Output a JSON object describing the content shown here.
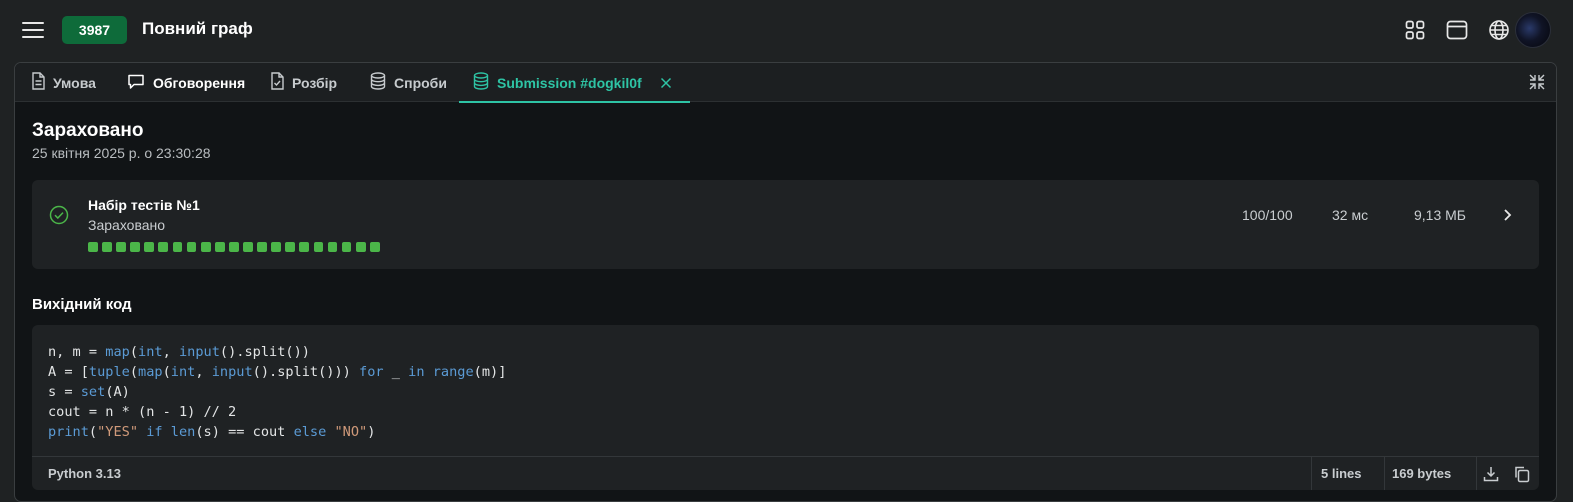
{
  "header": {
    "problem_id": "3987",
    "title": "Повний граф",
    "icons": [
      "apps-grid-icon",
      "window-icon",
      "globe-icon"
    ],
    "avatar": "user-avatar"
  },
  "tabs": [
    {
      "label": "Умова",
      "icon": "document-icon"
    },
    {
      "label": "Обговорення",
      "icon": "chat-bubble-icon"
    },
    {
      "label": "Розбір",
      "icon": "checklist-doc-icon"
    },
    {
      "label": "Спроби",
      "icon": "database-icon"
    },
    {
      "label": "Submission #dogkil0f",
      "icon": "database-icon",
      "active": true
    }
  ],
  "submission": {
    "status": "Зараховано",
    "date": "25 квітня 2025 р. о 23:30:28"
  },
  "testset": {
    "name": "Набір тестів №1",
    "status": "Зараховано",
    "score": "100/100",
    "time": "32 мс",
    "memory": "9,13 МБ",
    "passed_tests": 21,
    "total_tests": 21
  },
  "source": {
    "heading": "Вихідний код",
    "language": "Python 3.13",
    "lines_label": "5 lines",
    "bytes_label": "169 bytes"
  },
  "colors": {
    "accent": "#2ec4a5",
    "badge": "#0e6b3a",
    "pass": "#4bb649",
    "keyword": "#5b9bd5",
    "string": "#d09a7a"
  }
}
